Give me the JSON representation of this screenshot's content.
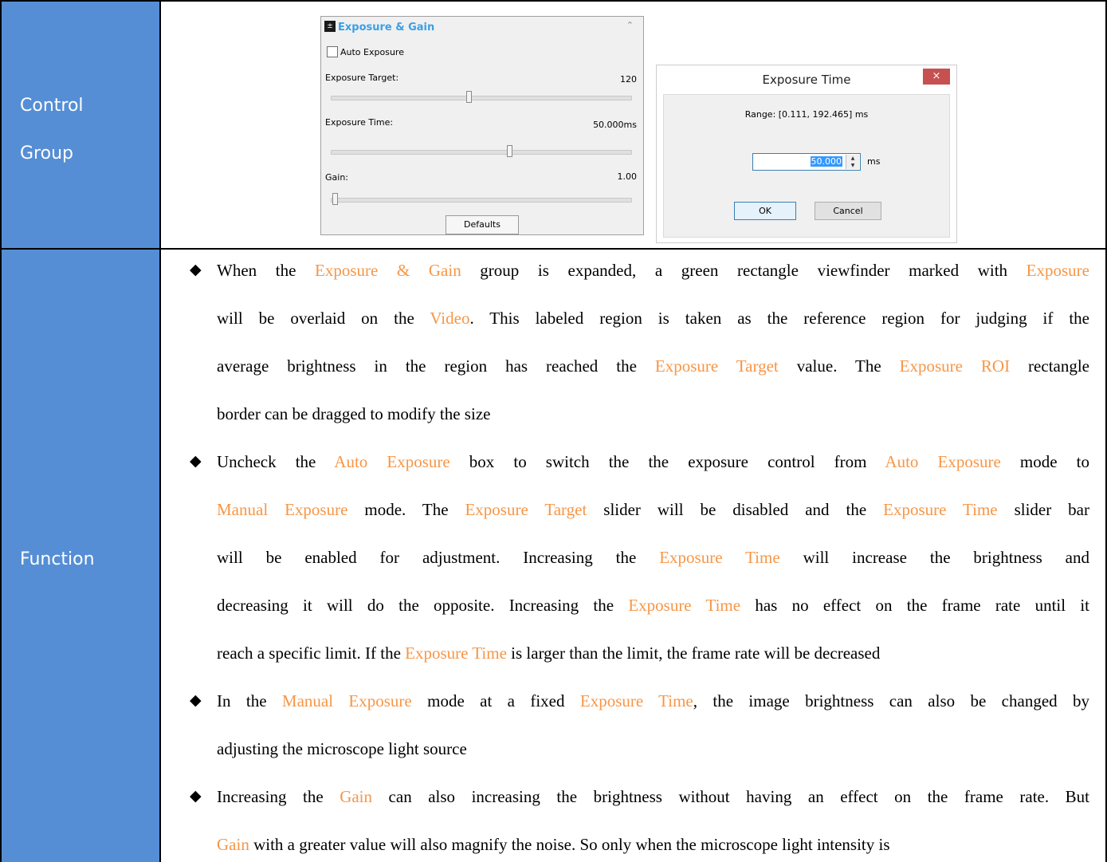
{
  "table": {
    "row1_label_line1": "Control",
    "row1_label_line2": "Group",
    "row2_label": "Function"
  },
  "exposure_panel": {
    "title": "Exposure & Gain",
    "icon": "exposure-icon",
    "collapse_icon": "double-chevron-up-icon",
    "auto_exposure_label": "Auto Exposure",
    "auto_exposure_checked": false,
    "target_label": "Exposure Target:",
    "target_value": "120",
    "time_label": "Exposure Time:",
    "time_value": "50.000ms",
    "gain_label": "Gain:",
    "gain_value": "1.00",
    "defaults_label": "Defaults"
  },
  "exposure_dialog": {
    "title": "Exposure Time",
    "close_label": "×",
    "range_text": "Range: [0.111, 192.465] ms",
    "input_value": "50.000",
    "unit": "ms",
    "ok_label": "OK",
    "cancel_label": "Cancel"
  },
  "function_bullets": [
    {
      "lines": [
        [
          [
            "When the ",
            false
          ],
          [
            "Exposure & Gain",
            true
          ],
          [
            " group is expanded,  a green rectangle viewfinder marked with ",
            false
          ],
          [
            "Exposure",
            true
          ]
        ],
        [
          [
            "will be overlaid on the ",
            false
          ],
          [
            "Video",
            true
          ],
          [
            ". This labeled region is taken as the reference region for judging if the",
            false
          ]
        ],
        [
          [
            "average brightness in the region has reached the ",
            false
          ],
          [
            "Exposure Target",
            true
          ],
          [
            " value. The ",
            false
          ],
          [
            "Exposure ROI",
            true
          ],
          [
            " rectangle",
            false
          ]
        ],
        [
          [
            "border can be dragged to modify the size",
            false
          ]
        ]
      ]
    },
    {
      "lines": [
        [
          [
            "Uncheck the ",
            false
          ],
          [
            "Auto Exposure",
            true
          ],
          [
            " box to switch the the exposure control from ",
            false
          ],
          [
            "Auto Exposure",
            true
          ],
          [
            " mode to",
            false
          ]
        ],
        [
          [
            "Manual Exposure",
            true
          ],
          [
            " mode. The ",
            false
          ],
          [
            "Exposure Target",
            true
          ],
          [
            " slider will be disabled and the ",
            false
          ],
          [
            "Exposure Time",
            true
          ],
          [
            " slider bar",
            false
          ]
        ],
        [
          [
            "will be enabled for adjustment. Increasing the ",
            false
          ],
          [
            "Exposure Time",
            true
          ],
          [
            " will increase the brightness and",
            false
          ]
        ],
        [
          [
            "decreasing it will do the opposite. Increasing the ",
            false
          ],
          [
            "Exposure Time",
            true
          ],
          [
            " has no effect on the frame rate until it",
            false
          ]
        ],
        [
          [
            "reach a specific limit. If the ",
            false
          ],
          [
            "Exposure Time",
            true
          ],
          [
            " is larger than the limit, the frame rate will be decreased",
            false
          ]
        ]
      ]
    },
    {
      "lines": [
        [
          [
            "In the ",
            false
          ],
          [
            "Manual Exposure",
            true
          ],
          [
            " mode at a fixed ",
            false
          ],
          [
            "Exposure Time",
            true
          ],
          [
            ", the image brightness can also be changed by",
            false
          ]
        ],
        [
          [
            "adjusting the microscope light source",
            false
          ]
        ]
      ]
    },
    {
      "lines": [
        [
          [
            "Increasing the ",
            false
          ],
          [
            "Gain",
            true
          ],
          [
            " can also increasing the brightness without having an effect on the frame rate. But",
            false
          ]
        ],
        [
          [
            "Gain",
            true
          ],
          [
            " with a greater value will also magnify the noise. So only when the microscope light intensity is",
            false
          ]
        ]
      ]
    }
  ],
  "bullet_symbol": "◆"
}
